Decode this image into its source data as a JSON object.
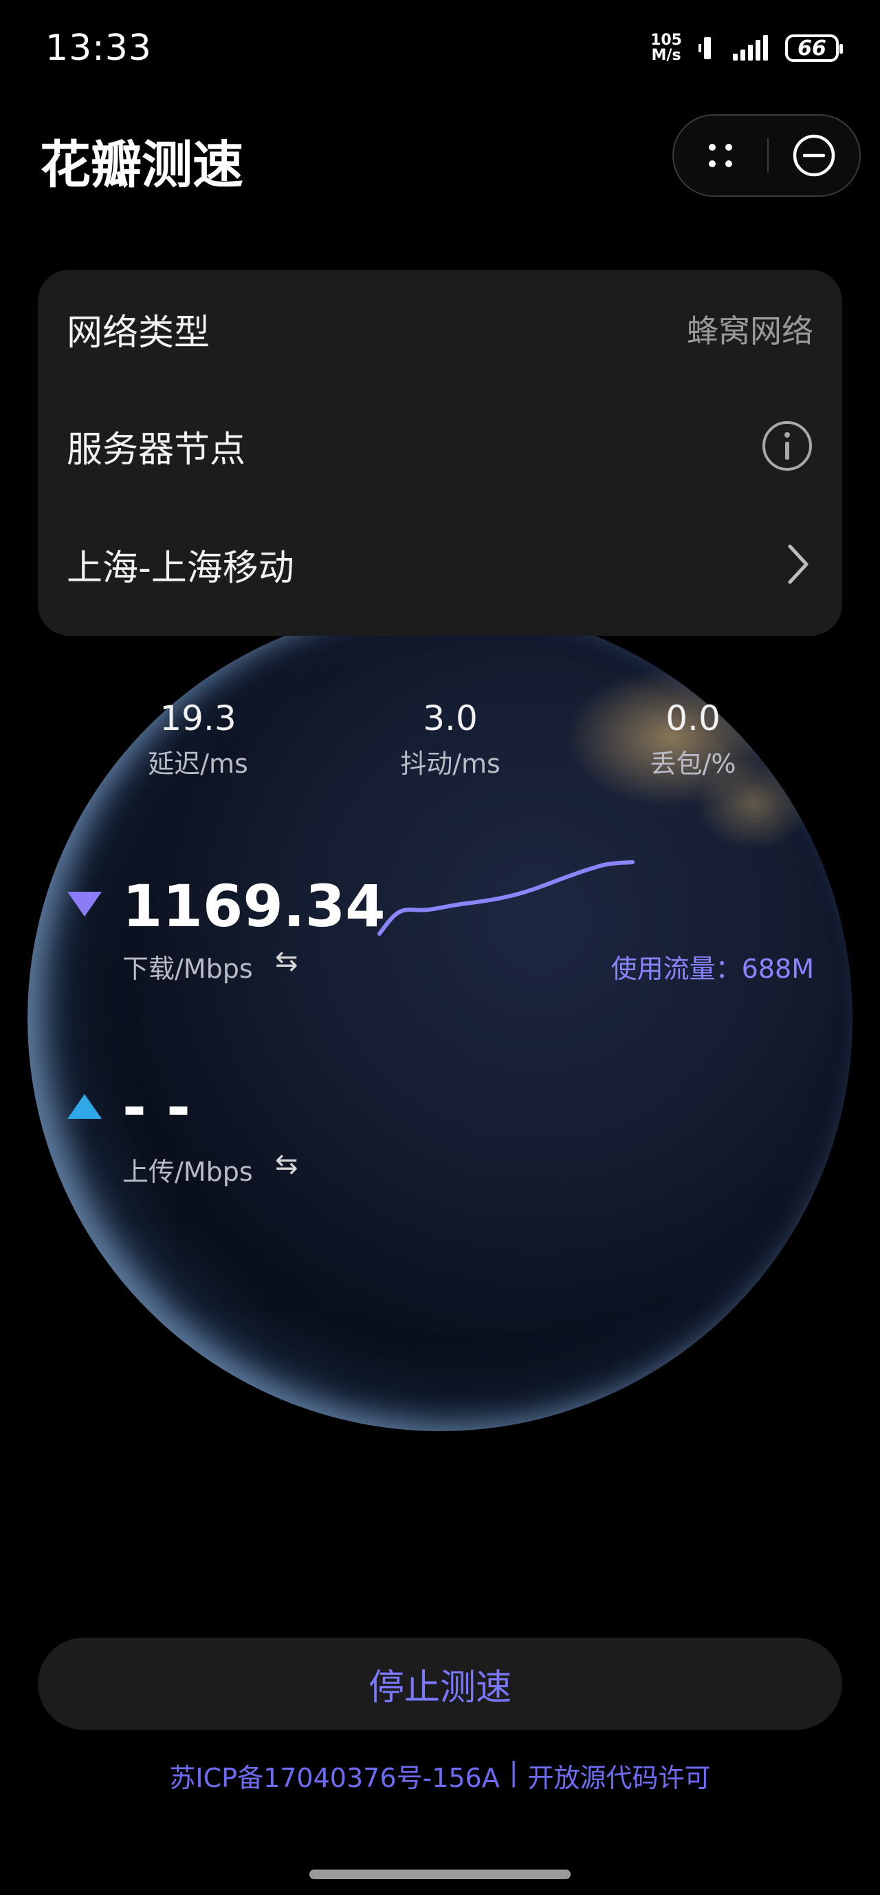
{
  "status_bar": {
    "time": "13:33",
    "net_speed_value": "105",
    "net_speed_unit": "M/s",
    "battery": "66"
  },
  "header": {
    "title": "花瓣测速",
    "more_icon": "more-dots-icon",
    "close_icon": "close-circle-icon"
  },
  "info_card": {
    "network_type_label": "网络类型",
    "network_type_value": "蜂窝网络",
    "server_label": "服务器节点",
    "server_value": "上海-上海移动",
    "info_icon": "info-icon",
    "chevron_icon": "chevron-right-icon"
  },
  "metrics": {
    "latency_value": "19.3",
    "latency_label": "延迟/ms",
    "jitter_value": "3.0",
    "jitter_label": "抖动/ms",
    "loss_value": "0.0",
    "loss_label": "丢包/%"
  },
  "download": {
    "value": "1169.34",
    "label": "下载/Mbps",
    "usage": "使用流量：688M",
    "icon": "download-triangle-icon",
    "swap_icon": "swap-icon"
  },
  "upload": {
    "value": "- -",
    "label": "上传/Mbps",
    "icon": "upload-triangle-icon",
    "swap_icon": "swap-icon"
  },
  "colors": {
    "accent": "#7a78ff",
    "download_triangle": "#8b7cf6",
    "upload_triangle": "#2fa8e8",
    "card_bg": "#1c1c1c"
  },
  "actions": {
    "stop_label": "停止测速"
  },
  "footer": {
    "icp": "苏ICP备17040376号-156A",
    "separator": "|",
    "license": "开放源代码许可"
  }
}
